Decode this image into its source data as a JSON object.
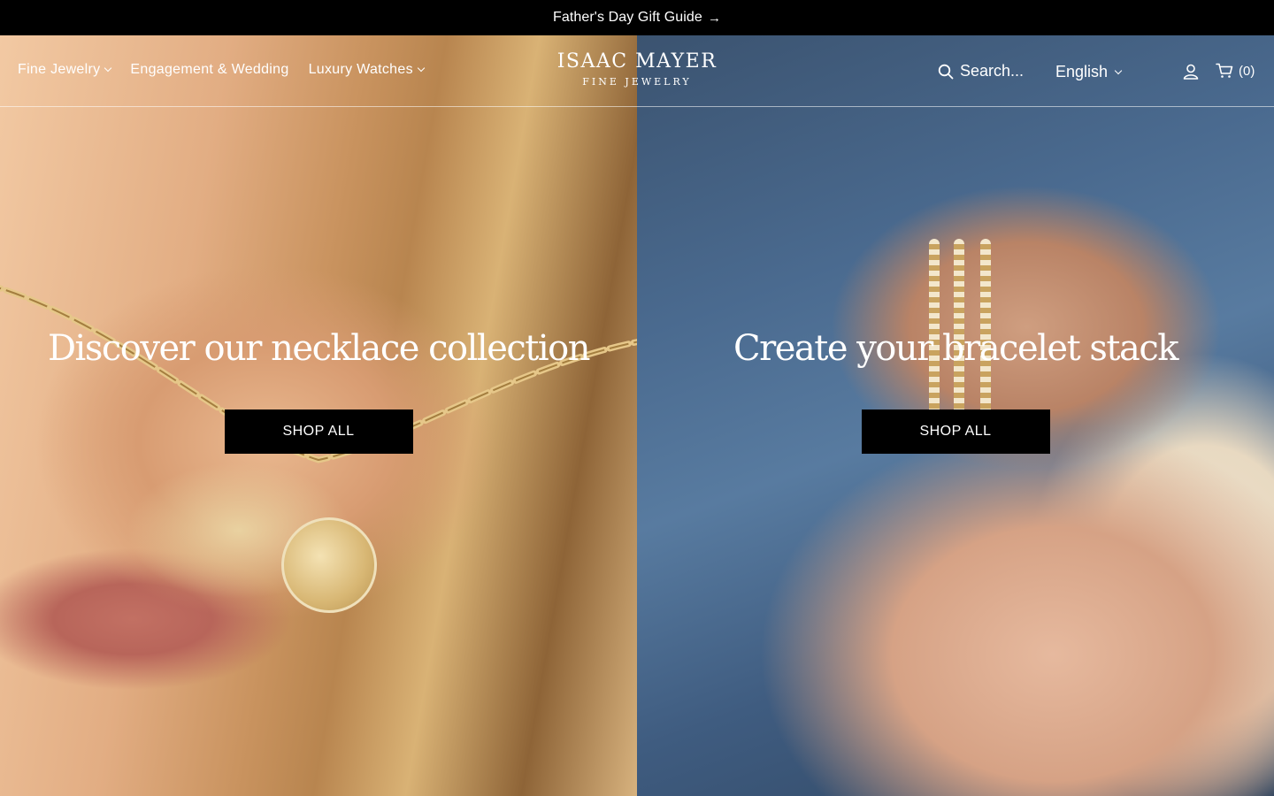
{
  "announcement": {
    "text": "Father's Day Gift Guide",
    "arrow": "→"
  },
  "nav": {
    "items": [
      {
        "label": "Fine Jewelry",
        "has_dropdown": true
      },
      {
        "label": "Engagement & Wedding",
        "has_dropdown": false
      },
      {
        "label": "Luxury Watches",
        "has_dropdown": true
      }
    ]
  },
  "logo": {
    "name": "ISAAC MAYER",
    "tagline": "FINE JEWELRY"
  },
  "search": {
    "label": "Search...",
    "icon": "search-icon"
  },
  "language": {
    "selected": "English",
    "icon": "chevron-down-icon"
  },
  "account": {
    "icon": "user-icon"
  },
  "cart": {
    "count_label": "(0)",
    "icon": "cart-icon"
  },
  "hero": {
    "left": {
      "heading": "Discover our necklace collection",
      "button": "SHOP ALL"
    },
    "right": {
      "heading": "Create your bracelet stack",
      "button": "SHOP ALL"
    }
  },
  "colors": {
    "bar": "#000000",
    "text": "#ffffff",
    "button": "#000000"
  }
}
